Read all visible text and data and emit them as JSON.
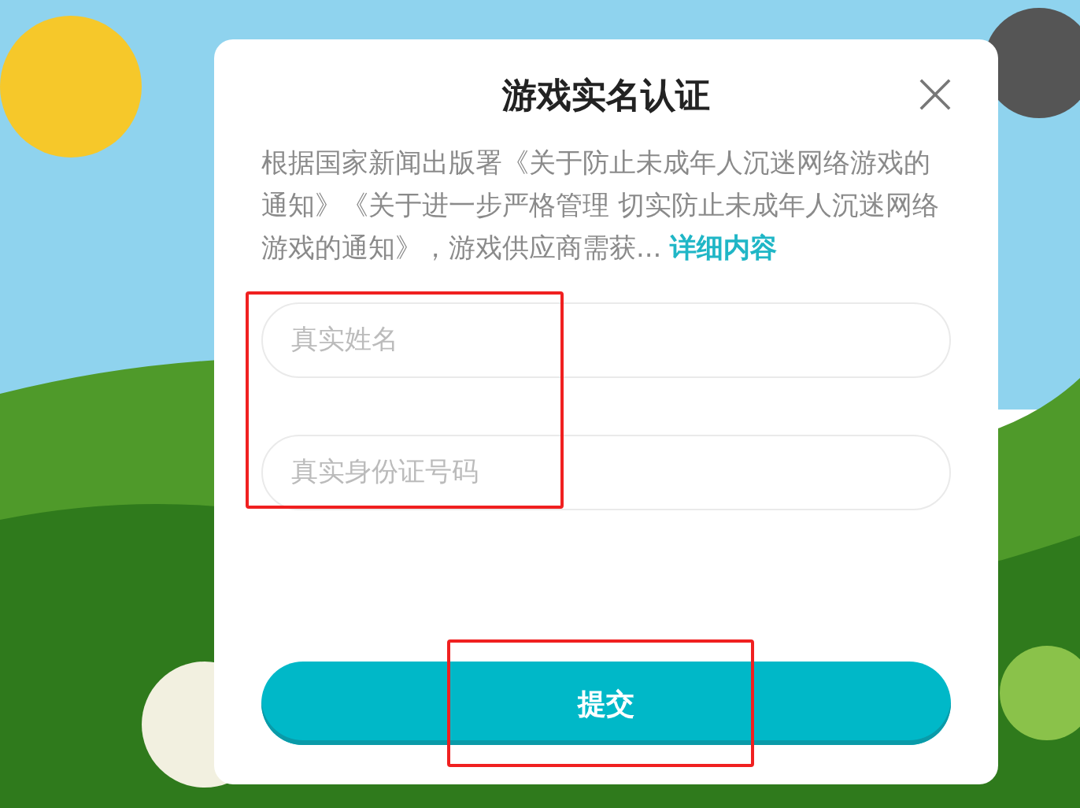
{
  "dialog": {
    "title": "游戏实名认证",
    "description": "根据国家新闻出版署《关于防止未成年人沉迷网络游戏的通知》《关于进一步严格管理 切实防止未成年人沉迷网络游戏的通知》，游戏供应商需获...",
    "details_link": "详细内容",
    "fields": [
      {
        "placeholder": "真实姓名"
      },
      {
        "placeholder": "真实身份证号码"
      }
    ],
    "submit_button": "提交"
  }
}
